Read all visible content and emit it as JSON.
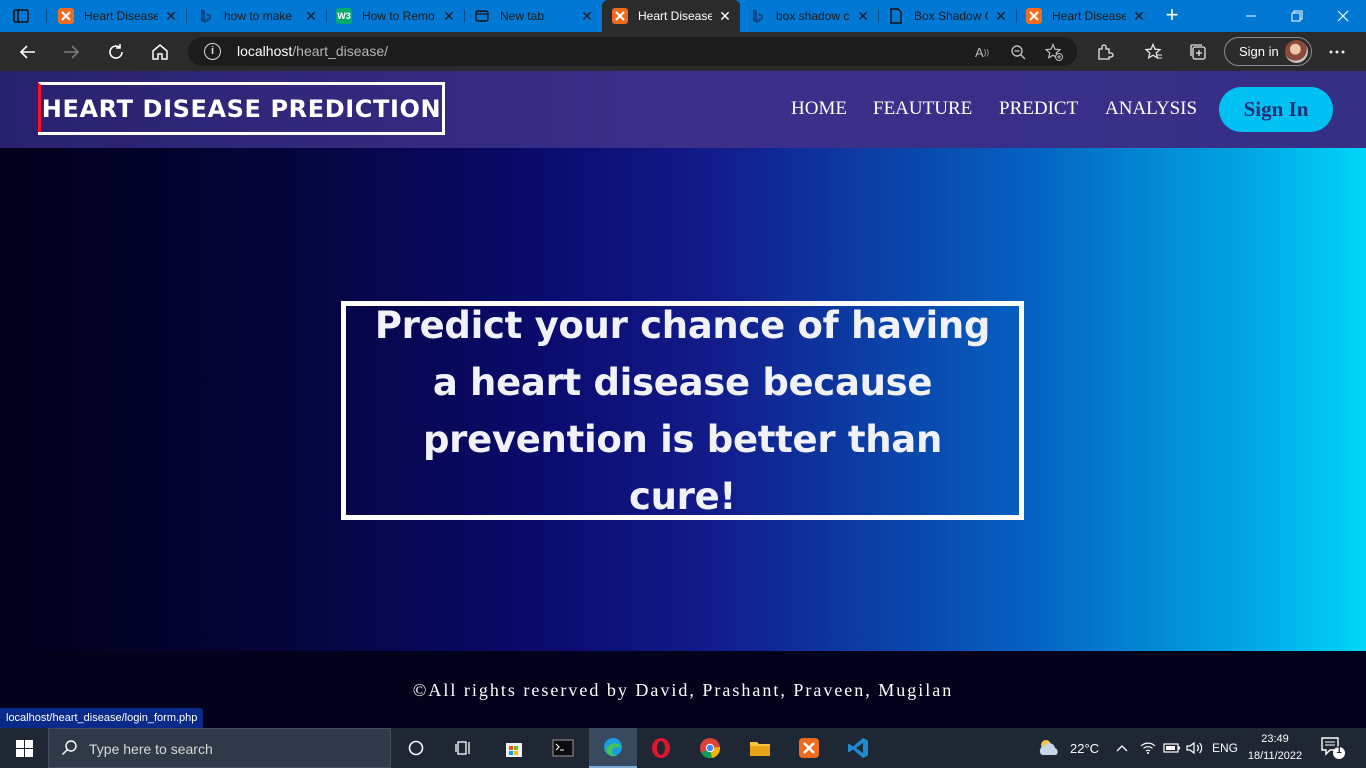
{
  "browser": {
    "tabs": [
      {
        "label": "Heart Disease",
        "icon": "xampp-icon",
        "active": false
      },
      {
        "label": "how to make",
        "icon": "bing-icon",
        "active": false
      },
      {
        "label": "How to Remo",
        "icon": "w3schools-icon",
        "active": false
      },
      {
        "label": "New tab",
        "icon": "newtab-icon",
        "active": false
      },
      {
        "label": "Heart Disease",
        "icon": "xampp-icon",
        "active": true
      },
      {
        "label": "box shadow c",
        "icon": "bing-icon",
        "active": false
      },
      {
        "label": "Box Shadow C",
        "icon": "document-icon",
        "active": false
      },
      {
        "label": "Heart Disease",
        "icon": "xampp-icon",
        "active": false
      }
    ],
    "close_glyph": "✕",
    "address": {
      "host": "localhost",
      "path": "/heart_disease/"
    },
    "signin_label": "Sign in",
    "status_url": "localhost/heart_disease/login_form.php"
  },
  "site": {
    "logo": "HEART DISEASE PREDICTION",
    "nav": [
      "HOME",
      "FEAUTURE",
      "PREDICT",
      "ANALYSIS"
    ],
    "signin": "Sign In",
    "hero": "Predict your chance of having a heart disease because prevention is better than cure!",
    "footer": "©All rights reserved by David, Prashant, Praveen, Mugilan"
  },
  "taskbar": {
    "search_placeholder": "Type here to search",
    "weather": "22°C",
    "language": "ENG",
    "time": "23:49",
    "date": "18/11/2022",
    "notification_count": "1"
  },
  "colors": {
    "browser_accent": "#0078d4",
    "signin_button": "#00c1f2",
    "logo_border": "#ff0f23"
  }
}
